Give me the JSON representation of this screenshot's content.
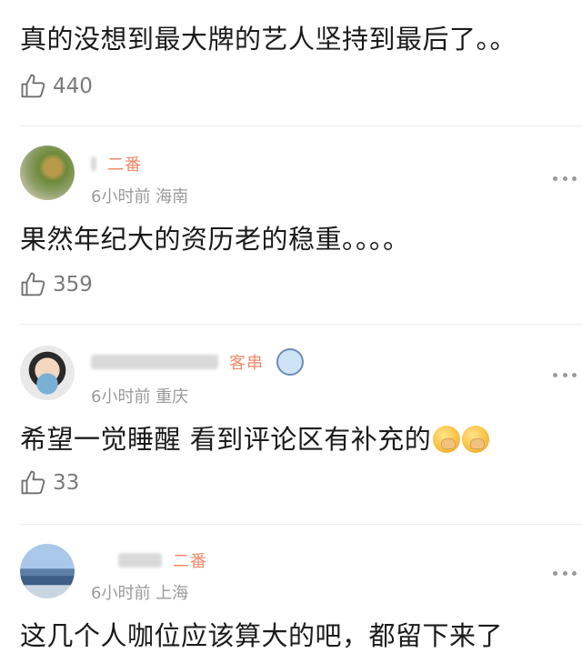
{
  "top_partial": {
    "meta_fragment": ""
  },
  "comments": [
    {
      "name": "",
      "badge": "",
      "meta": "",
      "text": "真的没想到最大牌的艺人坚持到最后了。。",
      "likes": "440"
    },
    {
      "name": "",
      "badge": "二番",
      "meta": "6小时前 海南",
      "text": "果然年纪大的资历老的稳重。。。。",
      "likes": "359"
    },
    {
      "name": "",
      "badge": "客串",
      "meta": "6小时前 重庆",
      "text": "希望一觉睡醒 看到评论区有补充的",
      "likes": "33",
      "emoji_count": 2
    },
    {
      "name": "",
      "badge": "二番",
      "meta": "6小时前 上海",
      "text": "这几个人咖位应该算大的吧，都留下来了",
      "likes": ""
    }
  ],
  "icons": {
    "like": "thumbs-up-icon",
    "more": "more-dots-icon",
    "emoji": "covering-mouth-emoji-icon",
    "sticker": "cartoon-sticker-icon"
  },
  "colors": {
    "badge": "#f08a6a",
    "meta": "#9a9a9a",
    "text": "#1b1b1b",
    "divider": "#ececec"
  }
}
